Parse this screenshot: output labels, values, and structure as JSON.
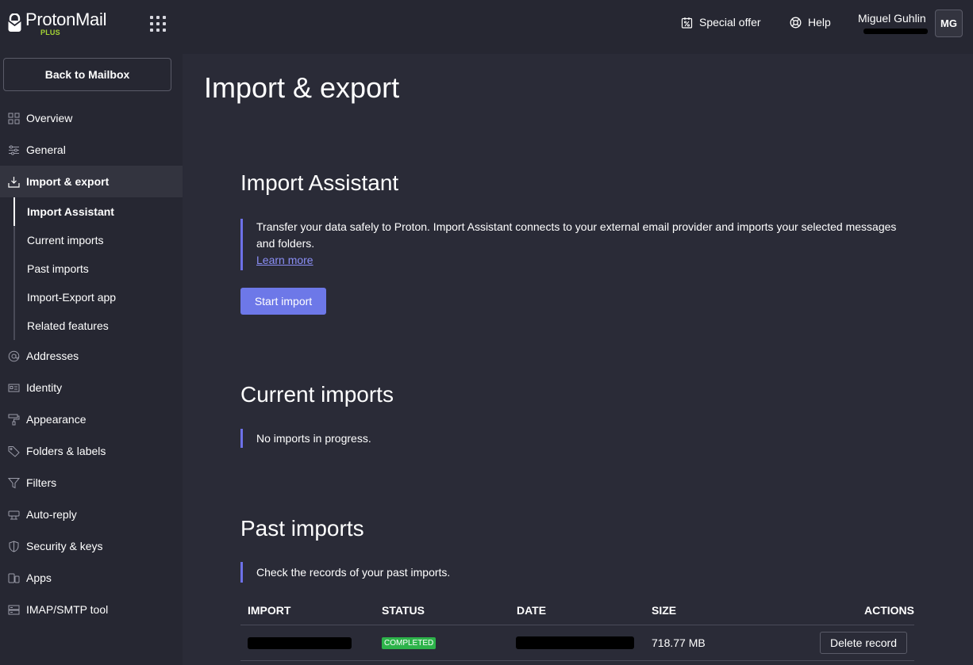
{
  "header": {
    "brand_name": "ProtonMail",
    "brand_plan": "PLUS",
    "special_offer_label": "Special offer",
    "help_label": "Help",
    "user_name": "Miguel Guhlin",
    "avatar_initials": "MG"
  },
  "sidebar": {
    "back_label": "Back to Mailbox",
    "items": [
      {
        "label": "Overview",
        "icon": "grid-icon"
      },
      {
        "label": "General",
        "icon": "sliders-icon"
      },
      {
        "label": "Import & export",
        "icon": "import-icon",
        "active": true
      },
      {
        "label": "Addresses",
        "icon": "at-icon"
      },
      {
        "label": "Identity",
        "icon": "id-card-icon"
      },
      {
        "label": "Appearance",
        "icon": "paint-roller-icon"
      },
      {
        "label": "Folders & labels",
        "icon": "tag-icon"
      },
      {
        "label": "Filters",
        "icon": "filter-icon"
      },
      {
        "label": "Auto-reply",
        "icon": "auto-reply-icon"
      },
      {
        "label": "Security & keys",
        "icon": "shield-icon"
      },
      {
        "label": "Apps",
        "icon": "apps-icon"
      },
      {
        "label": "IMAP/SMTP tool",
        "icon": "server-icon"
      }
    ],
    "sub_items": [
      {
        "label": "Import Assistant",
        "active": true
      },
      {
        "label": "Current imports"
      },
      {
        "label": "Past imports"
      },
      {
        "label": "Import-Export app"
      },
      {
        "label": "Related features"
      }
    ]
  },
  "main": {
    "page_title": "Import & export",
    "import_assistant": {
      "title": "Import Assistant",
      "description": "Transfer your data safely to Proton. Import Assistant connects to your external email provider and imports your selected messages and folders.",
      "learn_more": "Learn more",
      "start_button": "Start import"
    },
    "current_imports": {
      "title": "Current imports",
      "message": "No imports in progress."
    },
    "past_imports": {
      "title": "Past imports",
      "message": "Check the records of your past imports.",
      "columns": [
        "IMPORT",
        "STATUS",
        "DATE",
        "SIZE",
        "ACTIONS"
      ],
      "rows": [
        {
          "status": "COMPLETED",
          "size": "718.77 MB",
          "action": "Delete record"
        }
      ]
    }
  },
  "colors": {
    "accent": "#6d78e8",
    "status_completed": "#2db34a",
    "plan_badge": "#a5d534",
    "link": "#8a8ef5"
  }
}
